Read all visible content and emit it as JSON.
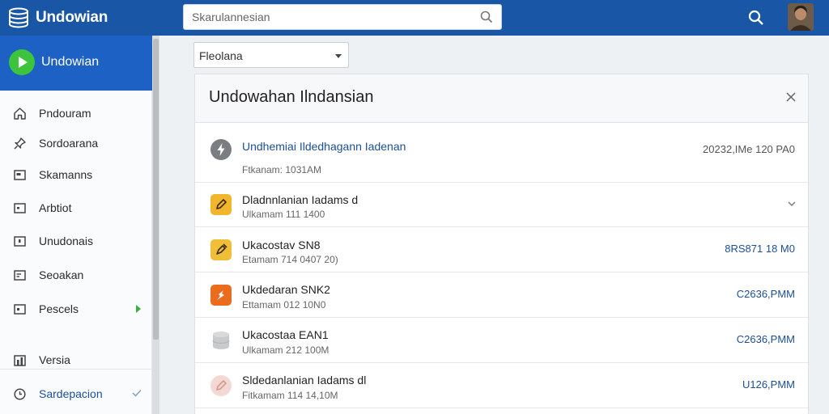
{
  "app": {
    "name": "Undowian"
  },
  "search": {
    "placeholder": "Skarulannesian"
  },
  "sidebar": {
    "header": "Undowian",
    "items": [
      {
        "label": "Pndouram",
        "icon": "home-icon"
      },
      {
        "label": "Sordoarana",
        "icon": "pin-icon"
      },
      {
        "label": "Skamanns",
        "icon": "inbox-icon"
      },
      {
        "label": "Arbtiot",
        "icon": "document-icon"
      },
      {
        "label": "Unudonais",
        "icon": "archive-icon"
      },
      {
        "label": "Seoakan",
        "icon": "note-icon"
      },
      {
        "label": "Pescels",
        "icon": "calendar-icon"
      }
    ],
    "bottom_items": [
      {
        "label": "Versia",
        "icon": "chart-icon"
      },
      {
        "label": "Sardepacion",
        "icon": "clock-icon"
      }
    ]
  },
  "filter": {
    "selected": "Fleolana"
  },
  "panel": {
    "title": "Undowahan Ilndansian",
    "rows": [
      {
        "title": "Undhemiai Ildedhagann Iadenan",
        "sub": "Ftkanam: 1031AM",
        "right": "20232,IMe 120 PA0",
        "icon": "bolt-icon"
      },
      {
        "title": "Dladnnlanian Iadams d",
        "sub": "Ulkamam 111 1400",
        "right": "",
        "icon": "pencil-icon"
      },
      {
        "title": "Ukacostav SN8",
        "sub": "Etamam 714 0407 20)",
        "right": "8RS871 18 M0",
        "icon": "pen-tool-icon"
      },
      {
        "title": "Ukdedaran SNK2",
        "sub": "Ettamam 012 10N0",
        "right": "C2636,PMM",
        "icon": "bolt-icon"
      },
      {
        "title": "Ukacostaa EAN1",
        "sub": "Ulkamam 212 100M",
        "right": "C2636,PMM",
        "icon": "database-icon"
      },
      {
        "title": "Sldedanlanian Iadams dl",
        "sub": "Fitkamam 114 14,10M",
        "right": "U126,PMM",
        "icon": "pencil-icon"
      }
    ]
  },
  "colors": {
    "topbar": "#1a56a6",
    "sidebar_header": "#1d61c4",
    "accent_green": "#3cc43c",
    "link_blue": "#1d4f93"
  }
}
